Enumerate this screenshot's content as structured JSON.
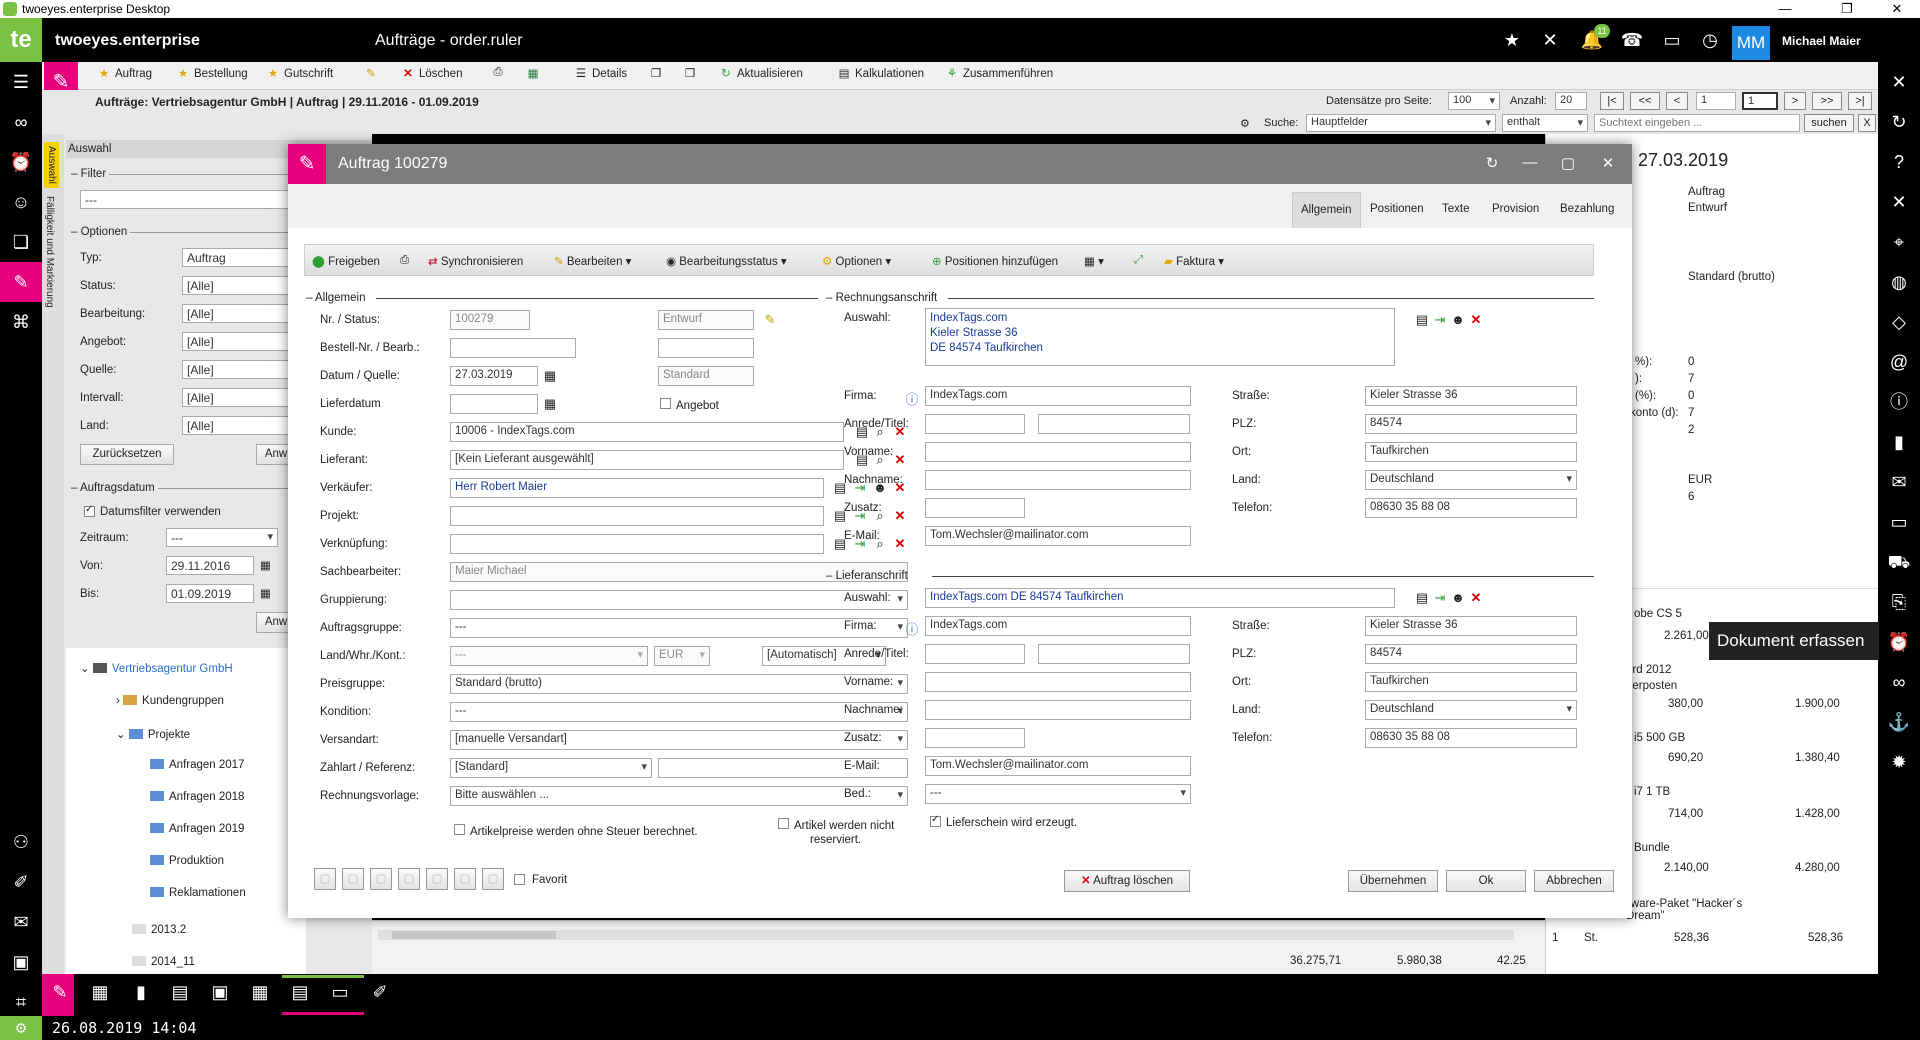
{
  "window": {
    "title": "twoeyes.enterprise Desktop"
  },
  "app": {
    "name": "twoeyes.enterprise",
    "module": "Aufträge - order.ruler",
    "notif_count": "11",
    "avatar": "MM",
    "user": "Michael Maier"
  },
  "toolbar": {
    "auftrag": "Auftrag",
    "bestellung": "Bestellung",
    "gutschrift": "Gutschrift",
    "loeschen": "Löschen",
    "details": "Details",
    "aktualisieren": "Aktualisieren",
    "kalkulationen": "Kalkulationen",
    "zusammenfuehren": "Zusammenführen"
  },
  "breadcrumb": "Aufträge: Vertriebsagentur GmbH | Auftrag | 29.11.2016 - 01.09.2019",
  "pager": {
    "per_page_label": "Datensätze pro Seite:",
    "per_page": "100",
    "count_label": "Anzahl:",
    "count": "20",
    "first": "|<",
    "prev_prev": "<<",
    "prev": "<",
    "page": "1",
    "page2": "1",
    "next": ">",
    "next_next": ">>",
    "last": ">|"
  },
  "search": {
    "label": "Suche:",
    "field": "Hauptfelder",
    "mode": "enthalt",
    "placeholder": "Suchtext eingeben ...",
    "button": "suchen",
    "clear": "X"
  },
  "left": {
    "tab_auswahl": "Auswahl",
    "tab_faelligkeit": "Fälligkeit und Markierung",
    "title": "Auswahl",
    "filter_label": "Filter",
    "filter_value": "---",
    "optionen_label": "Optionen",
    "typ_label": "Typ:",
    "typ_value": "Auftrag",
    "status_label": "Status:",
    "status_value": "[Alle]",
    "bearbeitung_label": "Bearbeitung:",
    "bearbeitung_value": "[Alle]",
    "angebot_label": "Angebot:",
    "angebot_value": "[Alle]",
    "quelle_label": "Quelle:",
    "quelle_value": "[Alle]",
    "intervall_label": "Intervall:",
    "intervall_value": "[Alle]",
    "land_label": "Land:",
    "land_value": "[Alle]",
    "reset_button": "Zurücksetzen",
    "apply_button": "Anw",
    "auftragsdatum_label": "Auftragsdatum",
    "datumsfilter_label": "Datumsfilter verwenden",
    "zeitraum_label": "Zeitraum:",
    "zeitraum_value": "---",
    "von_label": "Von:",
    "von_value": "29.11.2016",
    "bis_label": "Bis:",
    "bis_value": "01.09.2019",
    "apply2_button": "Anw",
    "tree": {
      "root": "Vertriebsagentur GmbH",
      "kundengruppen": "Kundengruppen",
      "projekte": "Projekte",
      "a2017": "Anfragen 2017",
      "a2018": "Anfragen 2018",
      "a2019": "Anfragen 2019",
      "produktion": "Produktion",
      "reklamationen": "Reklamationen",
      "y2013": "2013.2",
      "y2014": "2014_11"
    }
  },
  "rightdoc": {
    "date": "27.03.2019",
    "type": "Auftrag",
    "status": "Entwurf",
    "pricegroup": "Standard (brutto)",
    "k1": "%):",
    "v1": "0",
    "k2": "):",
    "v2": "7",
    "k3": "(%):",
    "v3": "0",
    "k4": "konto (d):",
    "v4": "7",
    "v5": "2",
    "currency": "EUR",
    "cur_n": "6",
    "item1": "obe CS 5",
    "item1_a": "2.261,00",
    "item2": "ord 2012",
    "item2_b": "derposten",
    "item2_a": "380,00",
    "item2_c": "1.900,00",
    "item3": "i5 500 GB",
    "item3_a": "690,20",
    "item3_c": "1.380,40",
    "item4": "i7 1 TB",
    "item4_a": "714,00",
    "item4_c": "1.428,00",
    "item5": "Bundle",
    "item5_a": "2.140,00",
    "item5_c": "4.280,00",
    "item6": "oftware-Paket \"Hacker´s",
    "item6_b": "Dream\"",
    "item6_n": "1",
    "item6_u": "St.",
    "item6_a": "528,36",
    "item6_c": "528,36"
  },
  "bottom": {
    "sum1": "36.275,71",
    "sum2": "5.980,38",
    "sum3": "42.25"
  },
  "tooltip": "Dokument erfassen",
  "status": {
    "time": "26.08.2019 14:04"
  },
  "dialog": {
    "title": "Auftrag 100279",
    "tabs": [
      "Allgemein",
      "Positionen",
      "Texte",
      "Provision",
      "Bezahlung"
    ],
    "tb": {
      "freigeben": "Freigeben",
      "synchronisieren": "Synchronisieren",
      "bearbeiten": "Bearbeiten",
      "bearbeitungsstatus": "Bearbeitungsstatus",
      "optionen": "Optionen",
      "positionen_hinzufuegen": "Positionen hinzufügen",
      "faktura": "Faktura"
    },
    "allgemein": {
      "header": "Allgemein",
      "nr_label": "Nr. / Status:",
      "nr": "100279",
      "status": "Entwurf",
      "bestell_label": "Bestell-Nr. / Bearb.:",
      "datum_label": "Datum / Quelle:",
      "datum": "27.03.2019",
      "quelle": "Standard",
      "lieferdatum_label": "Lieferdatum",
      "angebot_label": "Angebot",
      "kunde_label": "Kunde:",
      "kunde": "10006 - IndexTags.com",
      "lieferant_label": "Lieferant:",
      "lieferant": "[Kein Lieferant ausgewählt]",
      "verkaeufer_label": "Verkäufer:",
      "verkaeufer": "Herr Robert Maier",
      "projekt_label": "Projekt:",
      "verknuepfung_label": "Verknüpfung:",
      "sachbearbeiter_label": "Sachbearbeiter:",
      "sachbearbeiter": "Maier Michael",
      "gruppierung_label": "Gruppierung:",
      "auftragsgruppe_label": "Auftragsgruppe:",
      "auftragsgruppe": "---",
      "land_label": "Land/Whr./Kont.:",
      "land": "---",
      "waehrung": "EUR",
      "kont": "[Automatisch]",
      "preisgruppe_label": "Preisgruppe:",
      "preisgruppe": "Standard (brutto)",
      "kondition_label": "Kondition:",
      "kondition": "---",
      "versandart_label": "Versandart:",
      "versandart": "[manuelle Versandart]",
      "zahlart_label": "Zahlart / Referenz:",
      "zahlart": "[Standard]",
      "rechnungsvorlage_label": "Rechnungsvorlage:",
      "rechnungsvorlage": "Bitte auswählen ...",
      "ohne_steuer": "Artikelpreise werden ohne Steuer berechnet.",
      "nicht_reserviert_1": "Artikel werden nicht",
      "nicht_reserviert_2": "reserviert.",
      "favorit": "Favorit"
    },
    "rechnung": {
      "header": "Rechnungsanschrift",
      "auswahl_label": "Auswahl:",
      "addr1": "IndexTags.com",
      "addr2": "Kieler Strasse 36",
      "addr3": "DE 84574 Taufkirchen",
      "firma_label": "Firma:",
      "firma": "IndexTags.com",
      "anrede_label": "Anrede/Titel:",
      "vorname_label": "Vorname:",
      "nachname_label": "Nachname:",
      "zusatz_label": "Zusatz:",
      "email_label": "E-Mail:",
      "email": "Tom.Wechsler@mailinator.com",
      "strasse_label": "Straße:",
      "strasse": "Kieler Strasse 36",
      "plz_label": "PLZ:",
      "plz": "84574",
      "ort_label": "Ort:",
      "ort": "Taufkirchen",
      "land_label": "Land:",
      "land": "Deutschland",
      "telefon_label": "Telefon:",
      "telefon": "08630 35 88 08"
    },
    "liefer": {
      "header": "Lieferanschrift",
      "auswahl_label": "Auswahl:",
      "auswahl": "IndexTags.com DE 84574 Taufkirchen",
      "firma_label": "Firma:",
      "firma": "IndexTags.com",
      "anrede_label": "Anrede/Titel:",
      "vorname_label": "Vorname:",
      "nachname_label": "Nachname:",
      "zusatz_label": "Zusatz:",
      "email_label": "E-Mail:",
      "email": "Tom.Wechsler@mailinator.com",
      "bed_label": "Bed.:",
      "bed": "---",
      "lieferschein": "Lieferschein wird erzeugt.",
      "strasse_label": "Straße:",
      "strasse": "Kieler Strasse 36",
      "plz_label": "PLZ:",
      "plz": "84574",
      "ort_label": "Ort:",
      "ort": "Taufkirchen",
      "land_label": "Land:",
      "land": "Deutschland",
      "telefon_label": "Telefon:",
      "telefon": "08630 35 88 08"
    },
    "buttons": {
      "delete": "Auftrag löschen",
      "apply": "Übernehmen",
      "ok": "Ok",
      "cancel": "Abbrechen"
    }
  }
}
